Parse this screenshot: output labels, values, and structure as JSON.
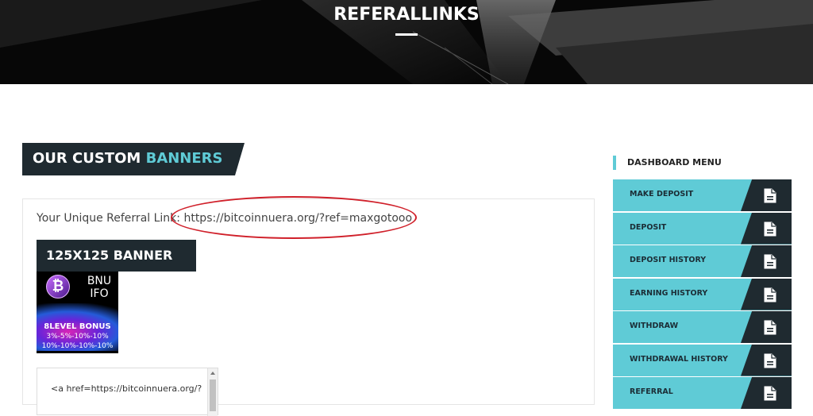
{
  "header": {
    "title": "REFERALLINKS"
  },
  "section": {
    "heading_main": "OUR CUSTOM ",
    "heading_accent": "BANNERS"
  },
  "referral": {
    "label": "Your Unique Referral Link: ",
    "link": "https://bitcoinnuera.org/?ref=maxgotooo"
  },
  "banner": {
    "title": "125X125 BANNER",
    "image_text_top_1": "BNU",
    "image_text_top_2": "IFO",
    "bonus_title": "8LEVEL BONUS",
    "bonus_line_1": "3%-5%-10%-10%",
    "bonus_line_2": "10%-10%-10%-10%",
    "code_snippet": "<a href=https://bitcoinnuera.org/?"
  },
  "sidebar": {
    "title": "DASHBOARD MENU",
    "items": [
      {
        "label": "MAKE DEPOSIT",
        "icon": "document-icon"
      },
      {
        "label": "DEPOSIT",
        "icon": "document-icon"
      },
      {
        "label": "DEPOSIT HISTORY",
        "icon": "document-icon"
      },
      {
        "label": "EARNING HISTORY",
        "icon": "document-icon"
      },
      {
        "label": "WITHDRAW",
        "icon": "document-icon"
      },
      {
        "label": "WITHDRAWAL HISTORY",
        "icon": "document-icon"
      },
      {
        "label": "REFERRAL",
        "icon": "document-icon"
      }
    ]
  },
  "colors": {
    "accent": "#5fcbd6",
    "dark": "#1f2a30",
    "highlight_circle": "#d0202a"
  }
}
